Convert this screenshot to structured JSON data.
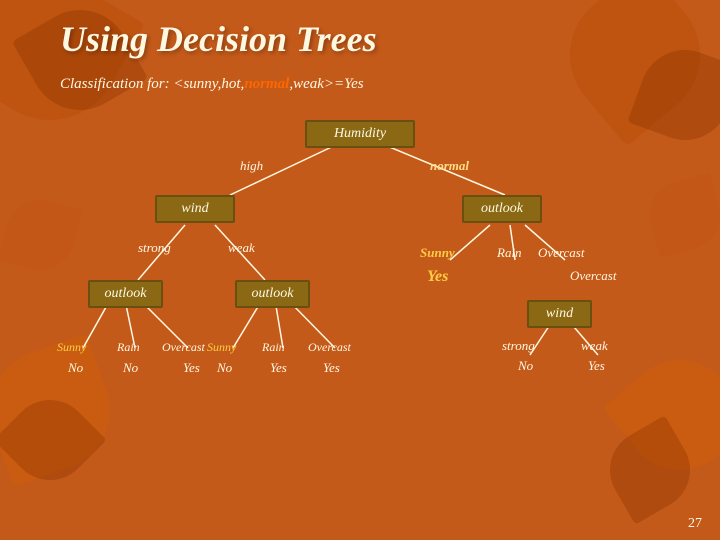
{
  "title": "Using Decision Trees",
  "classification": {
    "prefix": "Classification for:  ",
    "text": "<sunny,hot,",
    "highlight": "normal",
    "suffix": ",weak>=Yes"
  },
  "tree": {
    "root": "Humidity",
    "root_edges": [
      "high",
      "normal"
    ],
    "level2_left": "wind",
    "level2_right": "outlook",
    "level2_left_edges": [
      "strong",
      "weak"
    ],
    "level2_right_edges": [
      "Sunny",
      "Rain",
      "Overcast"
    ],
    "level3_ll": "outlook",
    "level3_lr": "outlook",
    "level3_ll_edges": [
      "Sunny",
      "Rain",
      "Overcast"
    ],
    "level3_lr_edges": [
      "Sunny",
      "Rain",
      "Overcast"
    ],
    "level3_r_wind": "wind",
    "level3_r_wind_yes": "Yes",
    "level3_r_wind_edges": [
      "strong",
      "weak"
    ],
    "leaves": {
      "ll_sunny": "No",
      "ll_rain": "No",
      "ll_overcast": "Yes",
      "lr_sunny": "No",
      "lr_rain": "Yes",
      "lr_overcast": "Yes",
      "r_sunny": "Yes",
      "r_rain_strong": "No",
      "r_overcast_weak": "Yes"
    }
  },
  "page_number": "27"
}
